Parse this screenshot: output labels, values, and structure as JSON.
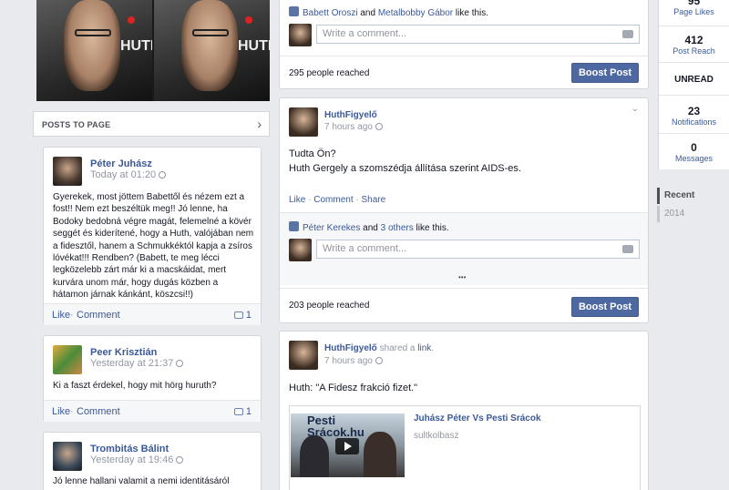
{
  "cover": {
    "brand_text": "HUTH"
  },
  "posts_to_page": {
    "header": "POSTS TO PAGE",
    "posts": [
      {
        "author": "Péter Juhász",
        "time": "Today at 01:20",
        "text": "Gyerekek, most jöttem Babettől és nézem ezt a fost!! Nem ezt beszéltük meg!! Jó lenne, ha Bodoky bedobná végre magát, felemelné a kövér seggét és kiderítené, hogy a Huth, valójában nem a fidesztől, hanem a Schmukkéktól kapja a zsíros lóvékat!!! Rendben? (Babett, te meg lécci legközelebb zárt már ki a macskáidat, mert kurvára unom már, hogy dugás közben a hátamon járnak kánkánt, köszcsi!!)",
        "like": "Like",
        "comment": "Comment",
        "count": "1"
      },
      {
        "author": "Peer Krisztián",
        "time": "Yesterday at 21:37",
        "text": "Ki a faszt érdekel, hogy mit hörg huruth?",
        "like": "Like",
        "comment": "Comment",
        "count": "1"
      },
      {
        "author": "Trombitás Bálint",
        "time": "Yesterday at 19:46",
        "text": "Jó lenne hallani valamit a nemi identitásáról"
      }
    ]
  },
  "feed": {
    "post0": {
      "likes_people": "Babett Oroszi",
      "likes_and": "and",
      "likes_people2": "Metalbobby Gábor",
      "likes_suffix": "like this.",
      "comment_placeholder": "Write a comment...",
      "reached": "295 people reached",
      "boost": "Boost Post"
    },
    "post1": {
      "author": "HuthFigyelő",
      "time": "7 hours ago",
      "line1": "Tudta Ön?",
      "line2": "Huth Gergely a szomszédja állítása szerint AIDS-es.",
      "like": "Like",
      "comment": "Comment",
      "share": "Share",
      "likes_people": "Péter Kerekes",
      "likes_and": "and",
      "likes_others": "3 others",
      "likes_suffix": "like this.",
      "comment_placeholder": "Write a comment...",
      "more": "•••",
      "reached": "203 people reached",
      "boost": "Boost Post"
    },
    "post2": {
      "author": "HuthFigyelő",
      "shared": "shared a",
      "shared_link": "link",
      "time": "7 hours ago",
      "text": "Huth: \"A Fidesz frakció fizet.\"",
      "link_title": "Juhász Péter Vs Pesti Srácok",
      "link_source": "sultkolbasz",
      "thumb_text": "Pesti Srácok.hu"
    }
  },
  "sidebar": {
    "stats": [
      {
        "num": "95",
        "label": "Page Likes"
      },
      {
        "num": "412",
        "label": "Post Reach"
      },
      {
        "num": "",
        "label": "UNREAD"
      },
      {
        "num": "23",
        "label": "Notifications"
      },
      {
        "num": "0",
        "label": "Messages"
      }
    ],
    "years": [
      "Recent",
      "2014"
    ]
  },
  "colors": {
    "accent": "#3b5998",
    "boost": "#4e69a2",
    "background": "#e9eaed"
  }
}
